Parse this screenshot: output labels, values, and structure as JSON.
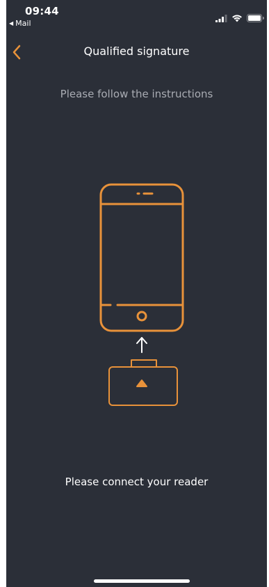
{
  "status_bar": {
    "time": "09:44",
    "back_app": "Mail",
    "icons": [
      "signal-icon",
      "wifi-icon",
      "battery-icon"
    ]
  },
  "nav": {
    "title": "Qualified signature",
    "back_icon": "chevron-left-icon"
  },
  "instructions": "Please follow the instructions",
  "illustration": {
    "phone_icon": "phone-icon",
    "arrow_icon": "arrow-up-icon",
    "reader_icon": "card-reader-icon"
  },
  "connect_text": "Please connect your reader",
  "colors": {
    "background": "#2b2f38",
    "accent": "#e8923a",
    "text": "#ffffff",
    "muted_text": "#a9acb3"
  }
}
